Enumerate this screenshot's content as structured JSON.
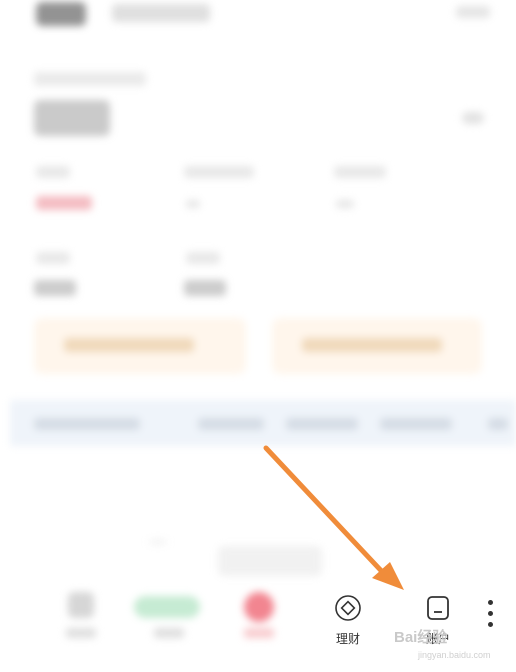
{
  "tabbar": {
    "items": [
      {
        "label": "理财",
        "icon": "diamond-circle-icon"
      },
      {
        "label": "账户",
        "icon": "wallet-icon"
      }
    ]
  },
  "watermark": {
    "text": "Bai经验",
    "sub": "jingyan.baidu.com"
  },
  "annotation": {
    "arrow_color": "#f08c3a"
  }
}
